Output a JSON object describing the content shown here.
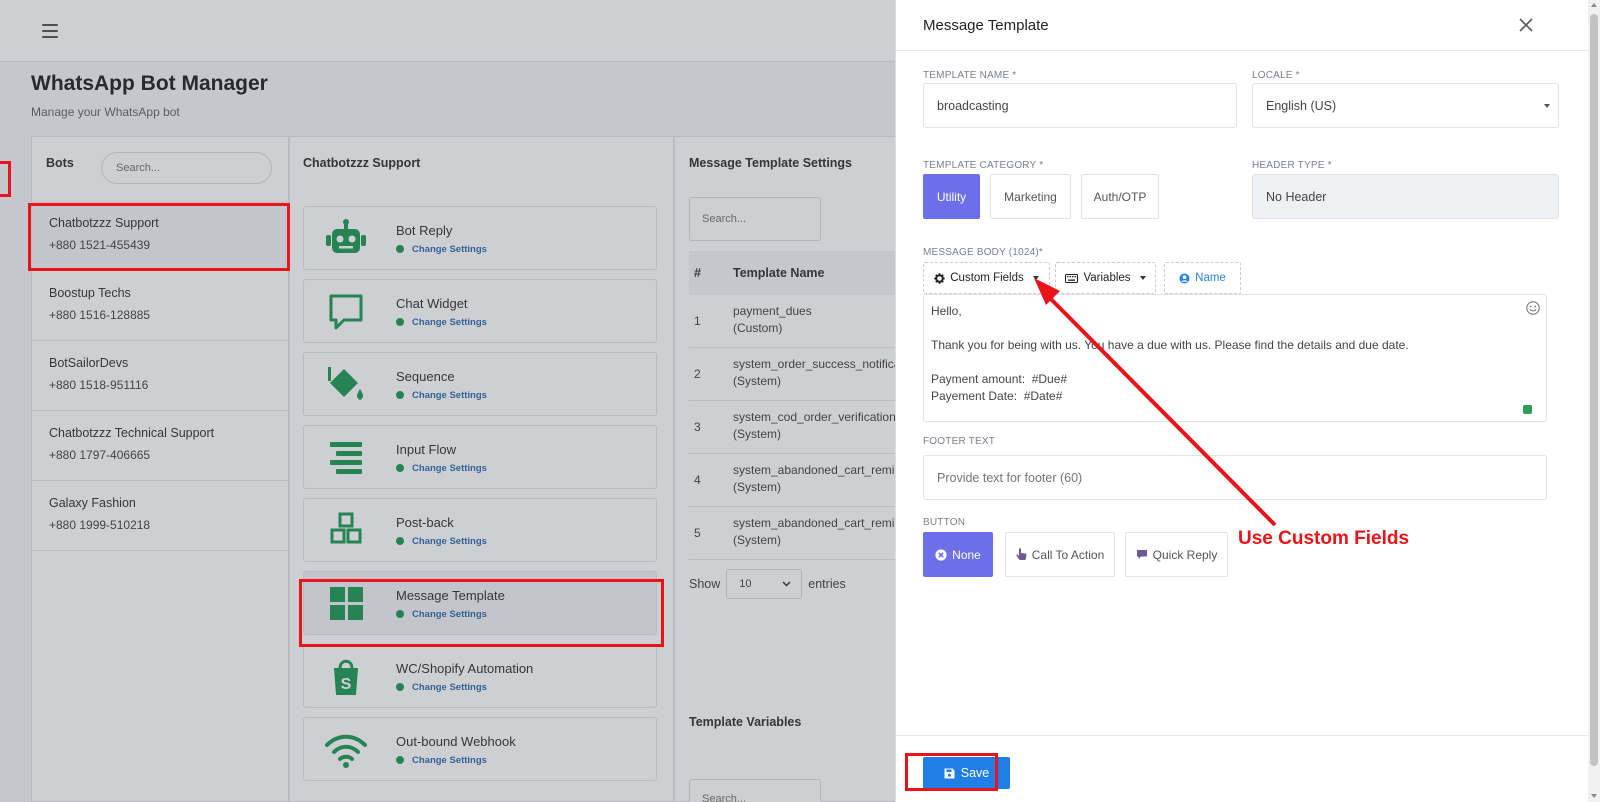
{
  "colors": {
    "accent": "#6c6fe8",
    "save": "#1f7fe6",
    "brand_green": "#1f9a56",
    "highlight_red": "#e8141a"
  },
  "page": {
    "title": "WhatsApp Bot Manager",
    "subtitle": "Manage your WhatsApp bot"
  },
  "bots": {
    "heading": "Bots",
    "search_placeholder": "Search...",
    "items": [
      {
        "name": "Chatbotzzz Support",
        "phone": "+880 1521-455439",
        "active": true
      },
      {
        "name": "Boostup Techs",
        "phone": "+880 1516-128885"
      },
      {
        "name": "BotSailorDevs",
        "phone": "+880 1518-951116"
      },
      {
        "name": "Chatbotzzz Technical Support",
        "phone": "+880 1797-406665"
      },
      {
        "name": "Galaxy Fashion",
        "phone": "+880 1999-510218"
      }
    ]
  },
  "settings": {
    "heading": "Chatbotzzz Support",
    "link_label": "Change Settings",
    "items": [
      {
        "title": "Bot Reply",
        "icon": "robot-icon"
      },
      {
        "title": "Chat Widget",
        "icon": "chat-bubble-icon"
      },
      {
        "title": "Sequence",
        "icon": "paint-bucket-icon"
      },
      {
        "title": "Input Flow",
        "icon": "align-lines-icon"
      },
      {
        "title": "Post-back",
        "icon": "cubes-icon"
      },
      {
        "title": "Message Template",
        "icon": "grid-icon"
      },
      {
        "title": "WC/Shopify Automation",
        "icon": "shopify-bag-icon"
      },
      {
        "title": "Out-bound Webhook",
        "icon": "wifi-icon"
      }
    ]
  },
  "templates": {
    "heading": "Message Template Settings",
    "search_placeholder": "Search...",
    "col_num": "#",
    "col_name": "Template Name",
    "rows": [
      {
        "num": "1",
        "name": "payment_dues",
        "type": "(Custom)"
      },
      {
        "num": "2",
        "name": "system_order_success_notificat",
        "type": "(System)"
      },
      {
        "num": "3",
        "name": "system_cod_order_verification_",
        "type": "(System)"
      },
      {
        "num": "4",
        "name": "system_abandoned_cart_remin",
        "type": "(System)"
      },
      {
        "num": "5",
        "name": "system_abandoned_cart_remin",
        "type": "(System)"
      }
    ],
    "show_label": "Show",
    "entries_value": "10",
    "entries_label": "entries",
    "variables_heading": "Template Variables",
    "variables_search_placeholder": "Search..."
  },
  "modal": {
    "title": "Message Template",
    "template_name": {
      "label": "TEMPLATE NAME *",
      "value": "broadcasting"
    },
    "locale": {
      "label": "LOCALE *",
      "value": "English (US)"
    },
    "category": {
      "label": "TEMPLATE CATEGORY *",
      "options": [
        "Utility",
        "Marketing",
        "Auth/OTP"
      ],
      "selected": "Utility"
    },
    "header_type": {
      "label": "HEADER TYPE *",
      "value": "No Header"
    },
    "message_body": {
      "label": "MESSAGE BODY (1024)*",
      "custom_fields_label": "Custom Fields",
      "variables_label": "Variables",
      "name_label": "Name",
      "lines": [
        "Hello,",
        "",
        "Thank you for being with us. You have a due with us. Please find the details and due date.",
        "",
        "Payment amount:  #Due#",
        "Payement Date:  #Date#"
      ]
    },
    "footer": {
      "label": "FOOTER TEXT",
      "placeholder": "Provide text for footer (60)"
    },
    "button": {
      "label": "BUTTON",
      "options": [
        "None",
        "Call To Action",
        "Quick Reply"
      ],
      "selected": "None"
    },
    "save_label": "Save"
  },
  "annotation": "Use Custom Fields"
}
